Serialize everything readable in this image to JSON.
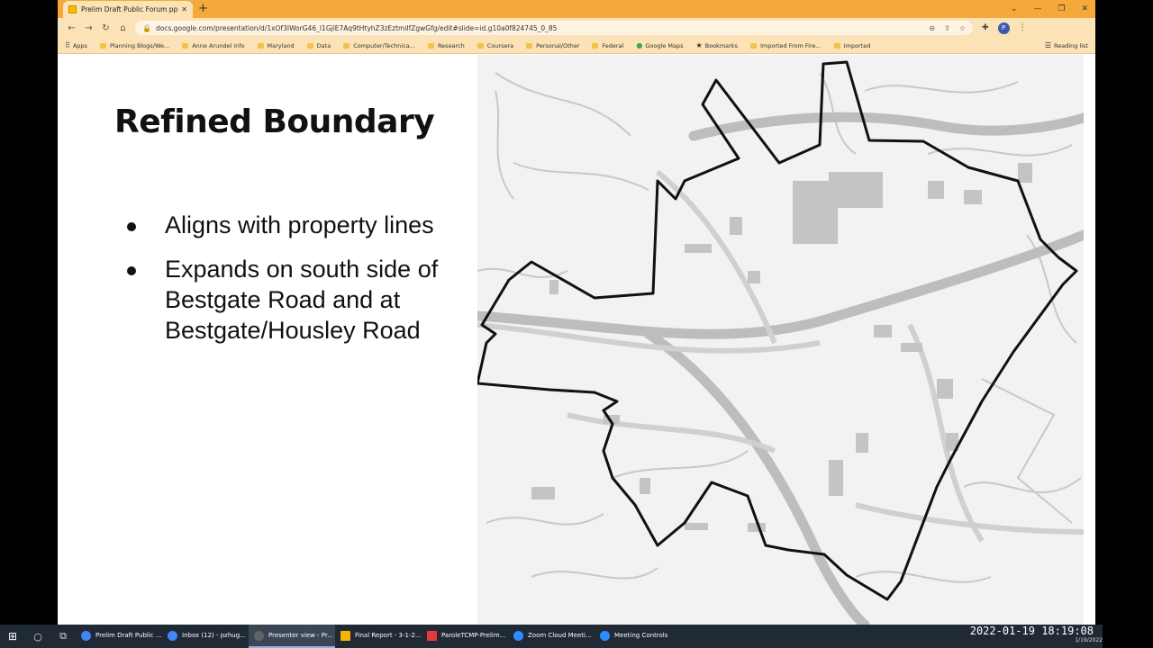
{
  "browser": {
    "tab_title": "Prelim Draft Public Forum ppt - G",
    "url": "docs.google.com/presentation/d/1xOf3IWorG46_I1GjlE7Aq9tHtyhZ3zEztmiIfZgwGfg/edit#slide=id.g10a0f824745_0_85",
    "profile_initial": "P",
    "bookmarks": [
      "Apps",
      "Planning Blogs/We...",
      "Anne Arundel info",
      "Maryland",
      "Data",
      "Computer/Technica...",
      "Research",
      "Coursera",
      "Personal/Other",
      "Federal",
      "Google Maps",
      "Bookmarks",
      "Imported From Fire...",
      "Imported"
    ],
    "reading_list": "Reading list"
  },
  "slide": {
    "title": "Refined Boundary",
    "bullets": [
      "Aligns with property lines",
      "Expands on south side of Bestgate Road and at Bestgate/Housley Road"
    ]
  },
  "taskbar": {
    "apps": [
      {
        "label": "Prelim Draft Public ...",
        "icon_color": "#4285f4",
        "active": false
      },
      {
        "label": "Inbox (12) - pzhug...",
        "icon_color": "#4285f4",
        "active": false
      },
      {
        "label": "Presenter view - Pr...",
        "icon_color": "#5f6368",
        "active": true
      },
      {
        "label": "Final Report - 3-1-2...",
        "icon_color": "#f4b400",
        "active": false
      },
      {
        "label": "ParoleTCMP-Prelim...",
        "icon_color": "#e53935",
        "active": false
      },
      {
        "label": "Zoom Cloud Meeti...",
        "icon_color": "#2d8cff",
        "active": false
      },
      {
        "label": "Meeting Controls",
        "icon_color": "#2d8cff",
        "active": false
      }
    ],
    "timestamp": "2022-01-19  18:19:08",
    "date": "1/19/2022"
  }
}
